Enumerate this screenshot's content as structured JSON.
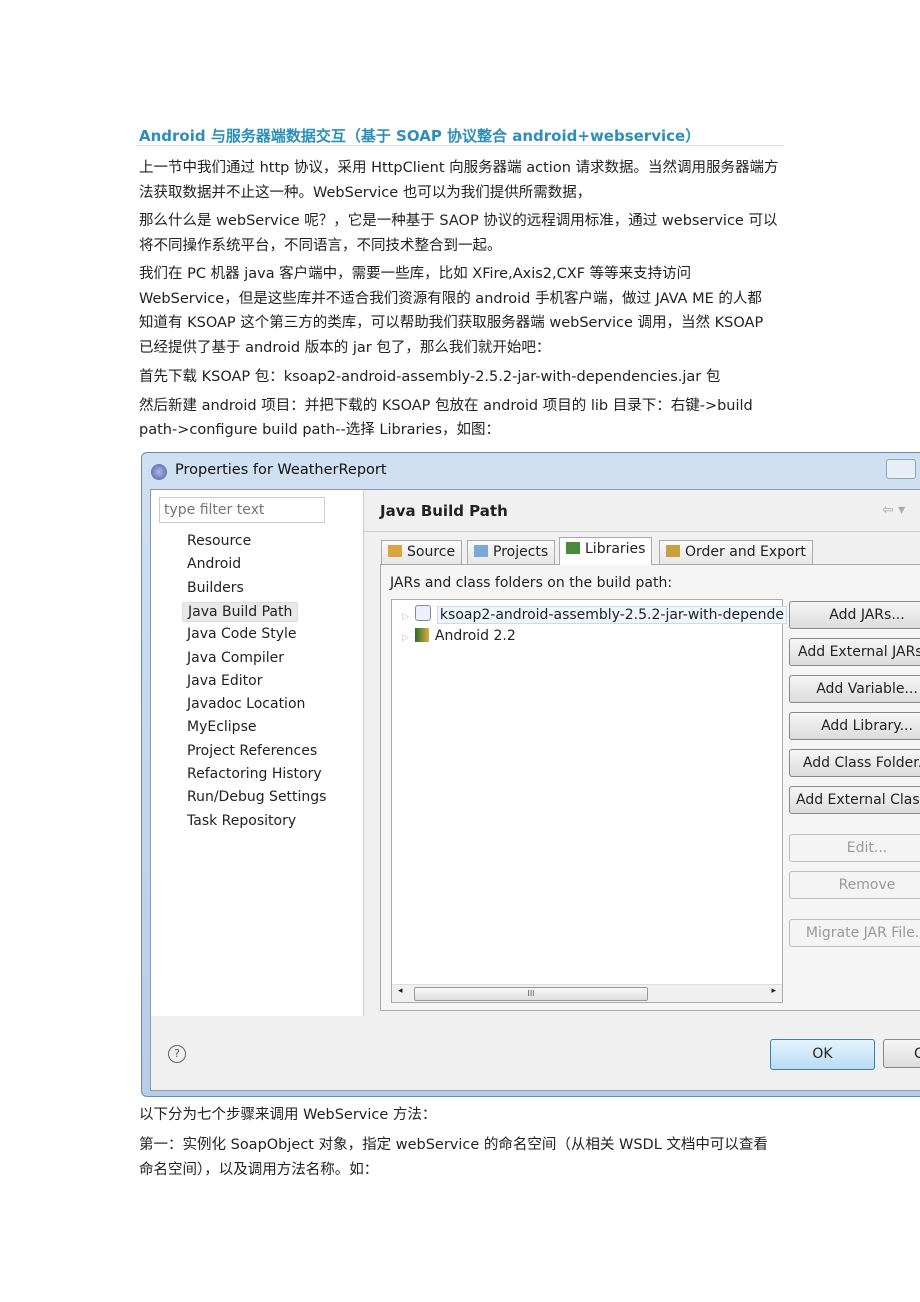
{
  "doc": {
    "title": "Android 与服务器端数据交互（基于 SOAP 协议整合 android+webservice）",
    "lines_before": [
      "上一节中我们通过 http 协议，采用 HttpClient 向服务器端 action 请求数据。当然调用服务器端方",
      "法获取数据并不止这一种。WebService 也可以为我们提供所需数据，",
      "那么什么是 webService 呢？，它是一种基于 SAOP 协议的远程调用标准，通过 webservice 可以",
      "将不同操作系统平台，不同语言，不同技术整合到一起。",
      "   我们在 PC 机器 java 客户端中，需要一些库，比如 XFire,Axis2,CXF 等等来支持访问",
      "WebService，但是这些库并不适合我们资源有限的 android 手机客户端，做过 JAVA ME 的人都",
      "知道有 KSOAP 这个第三方的类库，可以帮助我们获取服务器端 webService 调用，当然 KSOAP",
      "已经提供了基于 android 版本的 jar 包了，那么我们就开始吧：",
      "首先下载 KSOAP 包：ksoap2-android-assembly-2.5.2-jar-with-dependencies.jar 包",
      "然后新建 android 项目：并把下载的 KSOAP 包放在 android 项目的 lib 目录下：右键->build",
      "path->configure build path--选择 Libraries，如图："
    ],
    "lines_after": [
      "以下分为七个步骤来调用 WebService 方法：",
      "第一：实例化 SoapObject  对象，指定 webService 的命名空间（从相关 WSDL 文档中可以查看",
      "命名空间），以及调用方法名称。如："
    ]
  },
  "dialog": {
    "title": "Properties for WeatherReport",
    "filter_placeholder": "type filter text",
    "nav": [
      "Resource",
      "Android",
      "Builders",
      "Java Build Path",
      "Java Code Style",
      "Java Compiler",
      "Java Editor",
      "Javadoc Location",
      "MyEclipse",
      "Project References",
      "Refactoring History",
      "Run/Debug Settings",
      "Task Repository"
    ],
    "selected_nav": "Java Build Path",
    "page_title": "Java Build Path",
    "tabs": [
      "Source",
      "Projects",
      "Libraries",
      "Order and Export"
    ],
    "selected_tab": "Libraries",
    "panel_label": "JARs and class folders on the build path:",
    "tree": [
      "ksoap2-android-assembly-2.5.2-jar-with-depende",
      "Android 2.2"
    ],
    "scroll_grip": "III",
    "buttons": [
      "Add JARs...",
      "Add External JARs...",
      "Add Variable...",
      "Add Library...",
      "Add Class Folder...",
      "Add External Class Folder...",
      "Edit...",
      "Remove",
      "Migrate JAR File..."
    ],
    "disabled_buttons": [
      "Edit...",
      "Remove",
      "Migrate JAR File..."
    ],
    "ok": "OK",
    "cancel": "Cancel",
    "help": "?"
  },
  "colors": {
    "title": "#2e8fb6",
    "ok_border": "#3c7fb1"
  }
}
